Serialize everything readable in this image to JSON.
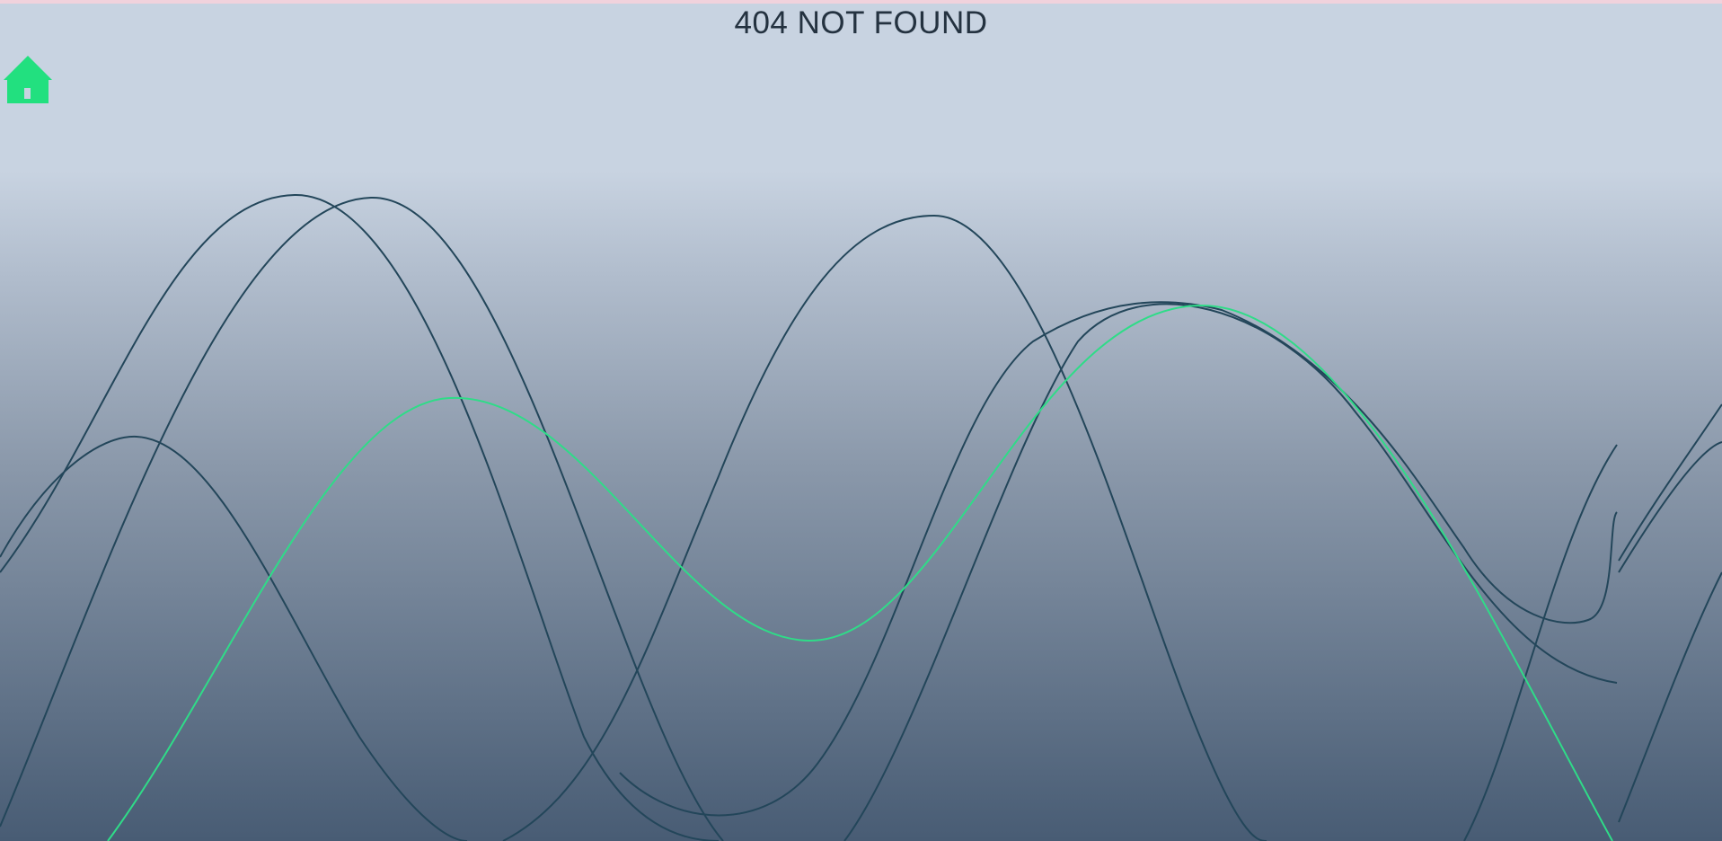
{
  "page": {
    "title": "404 NOT FOUND"
  },
  "home": {
    "icon": "home-icon",
    "color": "#22e07f"
  },
  "waves": {
    "dark_color": "#23465a",
    "accent_color": "#2fdc88"
  }
}
